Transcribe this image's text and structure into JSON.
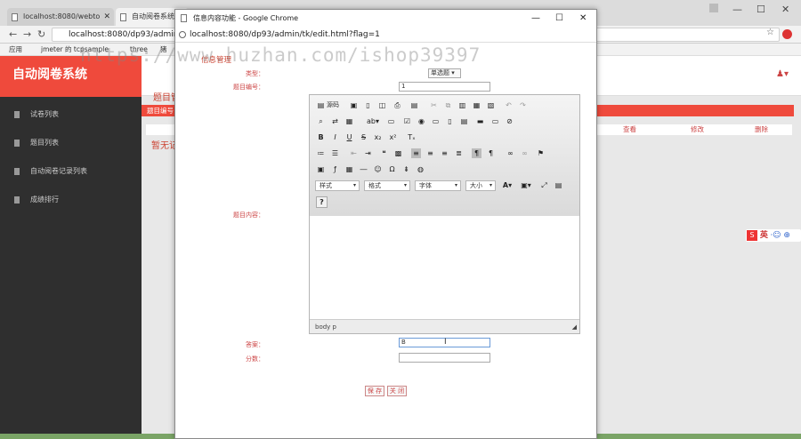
{
  "browser": {
    "tabs": [
      {
        "label": "localhost:8080/webto"
      },
      {
        "label": "自动阅卷系统"
      }
    ],
    "address": "localhost:8080/dp93/admin/in",
    "bookmarks": [
      "应用",
      "jmeter 的 tcpsample",
      "three",
      "猪"
    ]
  },
  "app": {
    "title": "自动阅卷系统",
    "sidebar": [
      {
        "label": "试卷列表"
      },
      {
        "label": "题目列表"
      },
      {
        "label": "自动阅卷记录列表"
      },
      {
        "label": "成绩排行"
      }
    ],
    "main": {
      "title": "题目管",
      "bar_label": "题目编号",
      "columns": [
        "查看",
        "修改",
        "删除"
      ],
      "empty_text": "暂无记"
    }
  },
  "popup": {
    "window_title": "信息内容功能 - Google Chrome",
    "address": "localhost:8080/dp93/admin/tk/edit.html?flag=1",
    "form": {
      "title": "信息管理",
      "type_label": "类型：",
      "type_value": "单选题",
      "number_label": "题目编号：",
      "number_value": "1",
      "content_label": "题目内容：",
      "answer_label": "答案：",
      "answer_value": "B",
      "score_label": "分数：",
      "score_value": "",
      "save_button": "保 存",
      "close_button": "关 闭"
    },
    "editor": {
      "source_label": "源码",
      "format_combo": "样式",
      "format2_combo": "格式",
      "font_combo": "字体",
      "size_combo": "大小",
      "status_path": "body  p"
    }
  },
  "ime": {
    "label": "英"
  },
  "watermark": "https://www.huzhan.com/ishop39397"
}
